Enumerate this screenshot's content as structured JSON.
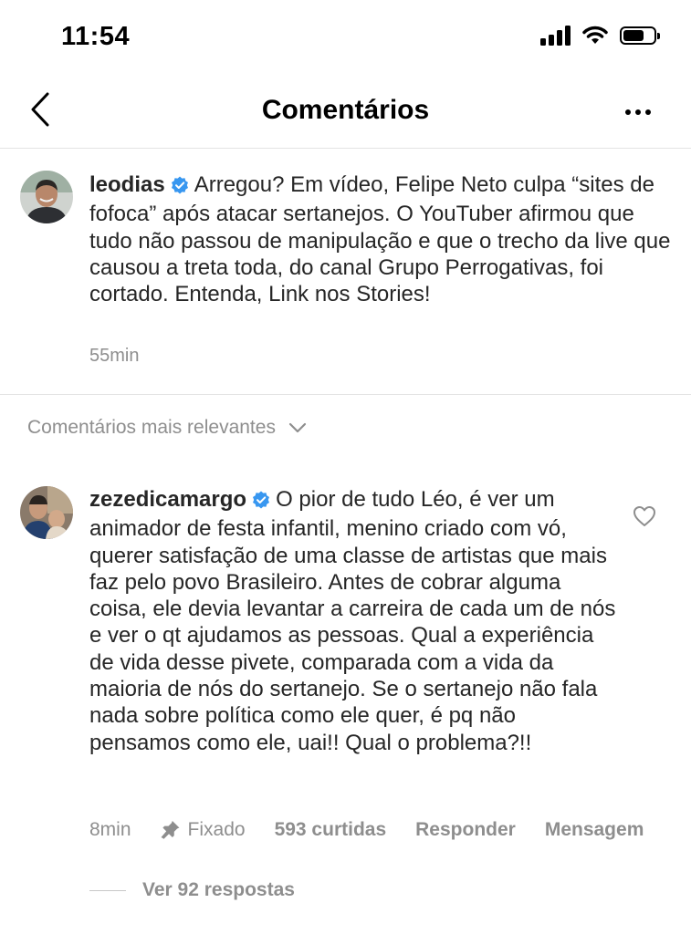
{
  "status_bar": {
    "time": "11:54",
    "battery_level": 0.7
  },
  "nav": {
    "title": "Comentários",
    "back_icon": "chevron-left-icon",
    "more_icon": "more-horizontal-icon"
  },
  "caption": {
    "username": "leodias",
    "verified": true,
    "text": "Arregou? Em vídeo, Felipe Neto culpa “sites de fofoca” após atacar sertanejos. O YouTuber afirmou que tudo não passou de manipulação e que o trecho da live que causou a treta toda, do canal Grupo Perrogativas, foi cortado. Entenda, Link nos Stories!",
    "time": "55min"
  },
  "sort": {
    "label": "Comentários mais relevantes",
    "icon": "chevron-down-icon"
  },
  "comment": {
    "username": "zezedicamargo",
    "verified": true,
    "text": "O pior de tudo Léo, é ver um animador de festa infantil, menino criado com vó, querer satisfação de uma classe de artistas que mais faz pelo povo Brasileiro. Antes de cobrar alguma coisa, ele devia levantar a carreira de cada um de nós e ver o qt ajudamos as pessoas. Qual a experiência de vida desse pivete, comparada com a vida da maioria de nós do sertanejo. Se o sertanejo não fala nada sobre política como ele quer, é pq não pensamos como ele, uai!! Qual o problema?!!",
    "time": "8min",
    "pinned_label": "Fixado",
    "likes": "593 curtidas",
    "reply_label": "Responder",
    "message_label": "Mensagem",
    "view_replies": "Ver 92 respostas"
  },
  "colors": {
    "text": "#262626",
    "muted": "#8e8e8e",
    "verified": "#3897f0",
    "divider": "#e4e4e4"
  }
}
